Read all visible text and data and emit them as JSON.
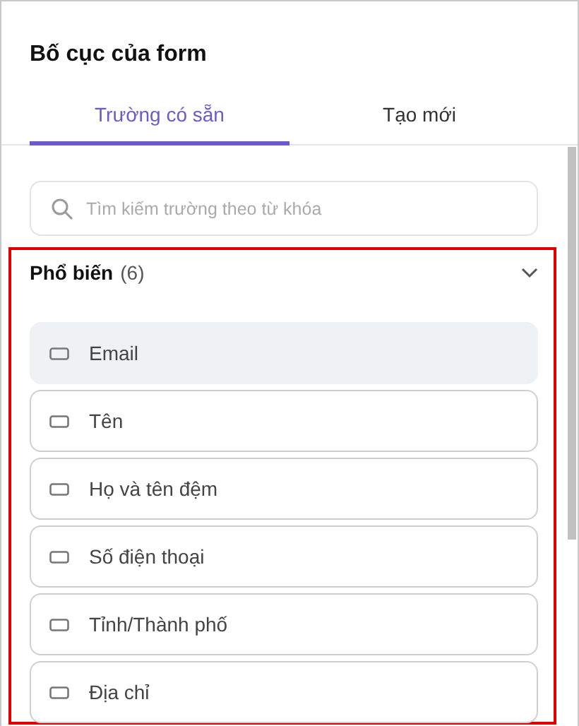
{
  "panel": {
    "title": "Bố cục của form"
  },
  "tabs": [
    {
      "label": "Trường có sẵn",
      "selected": true
    },
    {
      "label": "Tạo mới",
      "selected": false
    }
  ],
  "search": {
    "placeholder": "Tìm kiếm trường theo từ khóa"
  },
  "section": {
    "title": "Phổ biến",
    "count": "(6)",
    "expanded": true,
    "highlighted": true,
    "items": [
      {
        "label": "Email",
        "selected": true
      },
      {
        "label": "Tên",
        "selected": false
      },
      {
        "label": "Họ và tên đệm",
        "selected": false
      },
      {
        "label": "Số điện thoại",
        "selected": false
      },
      {
        "label": "Tỉnh/Thành phố",
        "selected": false
      },
      {
        "label": "Địa chỉ",
        "selected": false
      }
    ]
  }
}
